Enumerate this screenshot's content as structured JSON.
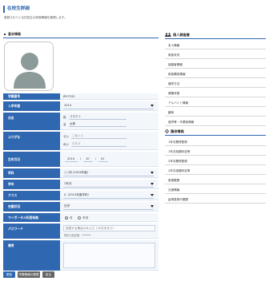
{
  "page": {
    "title": "在校生詳細",
    "description": "登録されている在校生の詳細情報を管理します。"
  },
  "basic": {
    "heading": "基本情報"
  },
  "fields": {
    "student_no": {
      "label": "学籍番号",
      "value": "JP07331"
    },
    "admission_year": {
      "label": "入学年度",
      "value": "2014"
    },
    "name": {
      "label": "氏名",
      "sei_prefix": "姓",
      "sei": "コネクト",
      "mei_prefix": "名",
      "mei": "太郎"
    },
    "furigana": {
      "label": "ふりがな",
      "sei_prefix": "せい",
      "sei": "こねくと",
      "mei_prefix": "めい",
      "mei": "たろう"
    },
    "birthday": {
      "label": "生年月日",
      "year": "2014",
      "month": "10",
      "day": "01"
    },
    "course": {
      "label": "学科",
      "value": "○○科 (2024年度)"
    },
    "grade": {
      "label": "学年",
      "value": "2年次"
    },
    "class": {
      "label": "クラス",
      "value": "A（2014年度学科）"
    },
    "status": {
      "label": "在籍状況",
      "value": "在学"
    },
    "mynumber": {
      "label": "マイポータル利用有無",
      "opt_yes": "可",
      "opt_no": "不可"
    },
    "password": {
      "label": "パスワード",
      "hint1": "変更する場合のみ入力（20文字まで）",
      "hint2": "現在の設定値：*******"
    },
    "notes": {
      "label": "備考",
      "value": ""
    }
  },
  "buttons": {
    "update": "更新",
    "history": "学籍情報の履歴",
    "back": "戻る"
  },
  "personal": {
    "heading": "個人調査書",
    "items": [
      "本人情報",
      "家族状況",
      "保護者情報",
      "家族構成情報",
      "通学方法",
      "健康状態",
      "アルバイト情報",
      "趣味",
      "進学等・卒業後情報"
    ]
  },
  "history": {
    "heading": "履修情報",
    "items": [
      "1年次履修登録",
      "1年次成績判定等",
      "2年次履修登録",
      "2年次成績判定等",
      "実習履歴",
      "欠席情報",
      "証明書発行履歴"
    ]
  },
  "colors": {
    "accent": "#2f67b1",
    "label_bg": "#2f67b1",
    "value_bg": "#f3f7fc"
  },
  "icons": {
    "section_marker": "square-bullet-icon",
    "personal": "users-icon",
    "history": "gear-icon",
    "dropdown": "caret-down-icon",
    "photo": "avatar-placeholder-icon"
  }
}
